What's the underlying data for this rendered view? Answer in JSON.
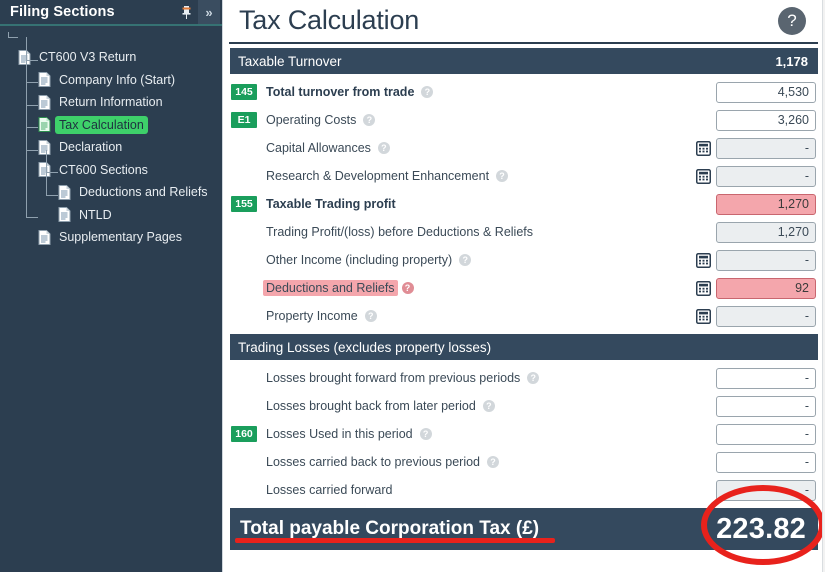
{
  "sidebar": {
    "title": "Filing Sections",
    "pin_icon": "pin-icon",
    "collapse_icon": "chevron-double-right-icon",
    "tree": [
      {
        "label": "CT600 V3 Return",
        "depth": 0,
        "selected": false,
        "icon": "document-icon"
      },
      {
        "label": "Company Info (Start)",
        "depth": 1,
        "selected": false,
        "icon": "document-icon"
      },
      {
        "label": "Return Information",
        "depth": 1,
        "selected": false,
        "icon": "document-icon"
      },
      {
        "label": "Tax Calculation",
        "depth": 1,
        "selected": true,
        "icon": "document-icon"
      },
      {
        "label": "Declaration",
        "depth": 1,
        "selected": false,
        "icon": "document-icon"
      },
      {
        "label": "CT600 Sections",
        "depth": 1,
        "selected": false,
        "icon": "document-icon"
      },
      {
        "label": "Deductions and Reliefs",
        "depth": 2,
        "selected": false,
        "icon": "document-icon"
      },
      {
        "label": "NTLD",
        "depth": 2,
        "selected": false,
        "icon": "document-icon"
      },
      {
        "label": "Supplementary Pages",
        "depth": 1,
        "selected": false,
        "icon": "document-icon"
      }
    ]
  },
  "header": {
    "title": "Tax Calculation",
    "help_icon": "question-mark-circle-icon"
  },
  "sections": [
    {
      "band_label": "Taxable Turnover",
      "band_value": "1,178",
      "rows": [
        {
          "badge": "145",
          "label": "Total turnover from trade",
          "bold": true,
          "help": true,
          "calc": false,
          "value": "4,530",
          "state": "editable",
          "highlight": false
        },
        {
          "badge": "E1",
          "label": "Operating Costs",
          "bold": false,
          "help": true,
          "calc": false,
          "value": "3,260",
          "state": "editable",
          "highlight": false
        },
        {
          "badge": "",
          "label": "Capital Allowances",
          "bold": false,
          "help": true,
          "calc": true,
          "value": "-",
          "state": "readonly",
          "highlight": false
        },
        {
          "badge": "",
          "label": "Research & Development Enhancement",
          "bold": false,
          "help": true,
          "calc": true,
          "value": "-",
          "state": "readonly",
          "highlight": false
        },
        {
          "badge": "155",
          "label": "Taxable Trading profit",
          "bold": true,
          "help": false,
          "calc": false,
          "value": "1,270",
          "state": "pink",
          "highlight": false
        },
        {
          "badge": "",
          "label": "Trading Profit/(loss) before Deductions & Reliefs",
          "bold": false,
          "help": false,
          "calc": false,
          "value": "1,270",
          "state": "readonly",
          "highlight": false
        },
        {
          "badge": "",
          "label": "Other Income (including property)",
          "bold": false,
          "help": true,
          "calc": true,
          "value": "-",
          "state": "readonly",
          "highlight": false
        },
        {
          "badge": "",
          "label": "Deductions and Reliefs",
          "bold": false,
          "help": true,
          "calc": true,
          "value": "92",
          "state": "pink",
          "highlight": true
        },
        {
          "badge": "",
          "label": "Property Income",
          "bold": false,
          "help": true,
          "calc": true,
          "value": "-",
          "state": "readonly",
          "highlight": false
        }
      ]
    },
    {
      "band_label": "Trading Losses (excludes property losses)",
      "band_value": "",
      "rows": [
        {
          "badge": "",
          "label": "Losses brought forward from previous periods",
          "bold": false,
          "help": true,
          "calc": false,
          "value": "-",
          "state": "editable",
          "highlight": false
        },
        {
          "badge": "",
          "label": "Losses brought back from later period",
          "bold": false,
          "help": true,
          "calc": false,
          "value": "-",
          "state": "editable",
          "highlight": false
        },
        {
          "badge": "160",
          "label": "Losses Used in this period",
          "bold": false,
          "help": true,
          "calc": false,
          "value": "-",
          "state": "editable",
          "highlight": false
        },
        {
          "badge": "",
          "label": "Losses carried back to previous period",
          "bold": false,
          "help": true,
          "calc": false,
          "value": "-",
          "state": "editable",
          "highlight": false
        },
        {
          "badge": "",
          "label": "Losses carried forward",
          "bold": false,
          "help": false,
          "calc": false,
          "value": "-",
          "state": "readonly",
          "highlight": false
        }
      ]
    }
  ],
  "total": {
    "label": "Total payable Corporation Tax (£)",
    "value": "223.82"
  },
  "annotations": {
    "underline_color": "#e8221c",
    "ellipse_color": "#e8221c"
  },
  "colors": {
    "sidebar_bg": "#2c3e50",
    "band_bg": "#34495e",
    "badge_green": "#1a9e5c",
    "selected_green": "#3ed06a",
    "pink": "#f4a6ac",
    "annotation_red": "#e8221c"
  }
}
